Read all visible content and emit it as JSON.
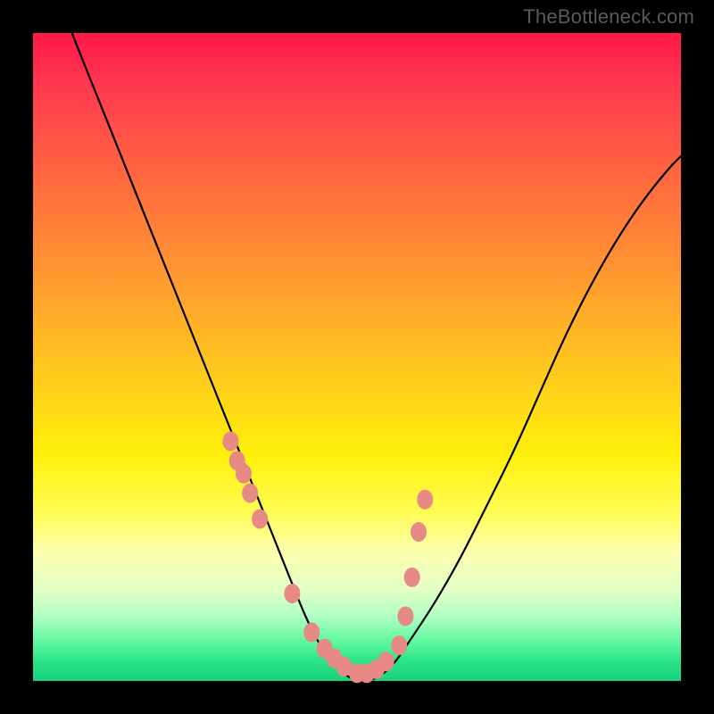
{
  "watermark": "TheBottleneck.com",
  "colors": {
    "curve": "#000000",
    "dot_fill": "#e78a86",
    "dot_stroke": "#d96f6b",
    "frame_bg": "#000000"
  },
  "chart_data": {
    "type": "line",
    "title": "",
    "xlabel": "",
    "ylabel": "",
    "xlim": [
      0,
      100
    ],
    "ylim": [
      0,
      100
    ],
    "series": [
      {
        "name": "bottleneck-curve",
        "x": [
          6,
          8,
          10,
          12,
          14,
          16,
          18,
          20,
          22,
          24,
          26,
          28,
          30,
          32,
          34,
          36,
          38,
          40,
          42,
          44,
          46,
          48,
          50,
          52,
          54,
          56,
          58,
          62,
          66,
          70,
          74,
          78,
          82,
          86,
          90,
          94,
          98,
          100
        ],
        "y": [
          100,
          95,
          90,
          85,
          80,
          75,
          70,
          65,
          60,
          55,
          50,
          45,
          40,
          35,
          30,
          25,
          20,
          15,
          10,
          6,
          3,
          1,
          0,
          0,
          1,
          3,
          6,
          12,
          19,
          27,
          35,
          44,
          53,
          61,
          68,
          74,
          79,
          81
        ]
      }
    ],
    "dots": {
      "name": "highlight-points",
      "x": [
        30.5,
        31.5,
        32.5,
        33.5,
        35.0,
        40.0,
        43.0,
        45.0,
        46.5,
        48.0,
        50.0,
        51.5,
        53.0,
        54.5,
        56.5,
        57.5,
        58.5,
        59.5,
        60.5
      ],
      "y": [
        37,
        34,
        32,
        29,
        25,
        13.5,
        7.5,
        5,
        3.5,
        2.2,
        1.2,
        1.2,
        1.8,
        3,
        5.5,
        10,
        16,
        23,
        28
      ]
    }
  }
}
